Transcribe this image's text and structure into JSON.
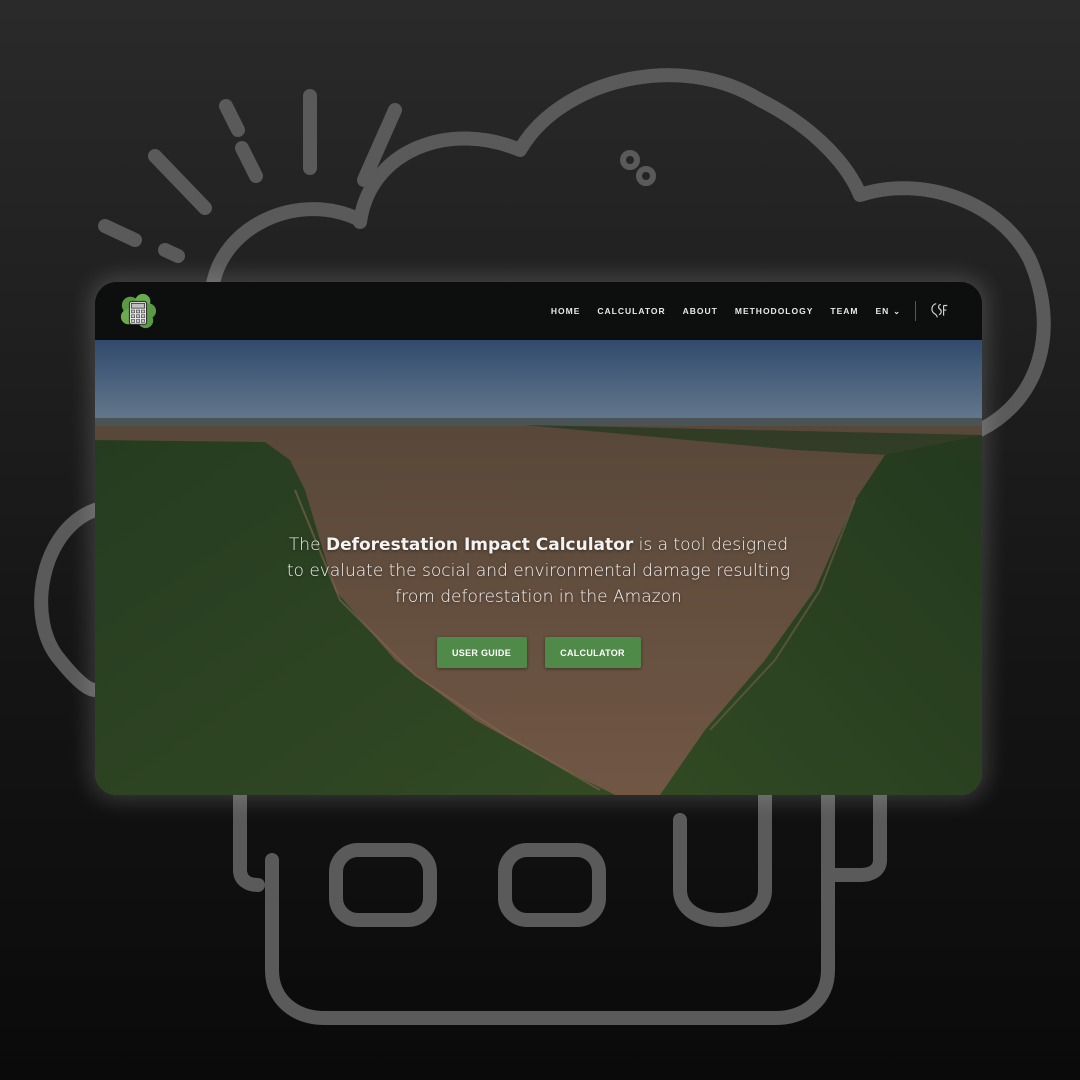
{
  "nav": {
    "items": [
      "HOME",
      "CALCULATOR",
      "ABOUT",
      "METHODOLOGY",
      "TEAM"
    ],
    "language": "EN",
    "partner_logo_icon": "csf-logo-icon",
    "app_logo_icon": "calculator-tree-logo-icon"
  },
  "hero": {
    "text_before": "The ",
    "text_strong": "Deforestation Impact Calculator",
    "text_after": " is a tool designed to evaluate the social and environmental damage resulting from deforestation in the Amazon",
    "buttons": {
      "user_guide": "USER GUIDE",
      "calculator": "CALCULATOR"
    }
  },
  "colors": {
    "button_green": "#4f8a49",
    "navbar_bg": "#0d0f0f",
    "background": "#1a1a1a"
  }
}
